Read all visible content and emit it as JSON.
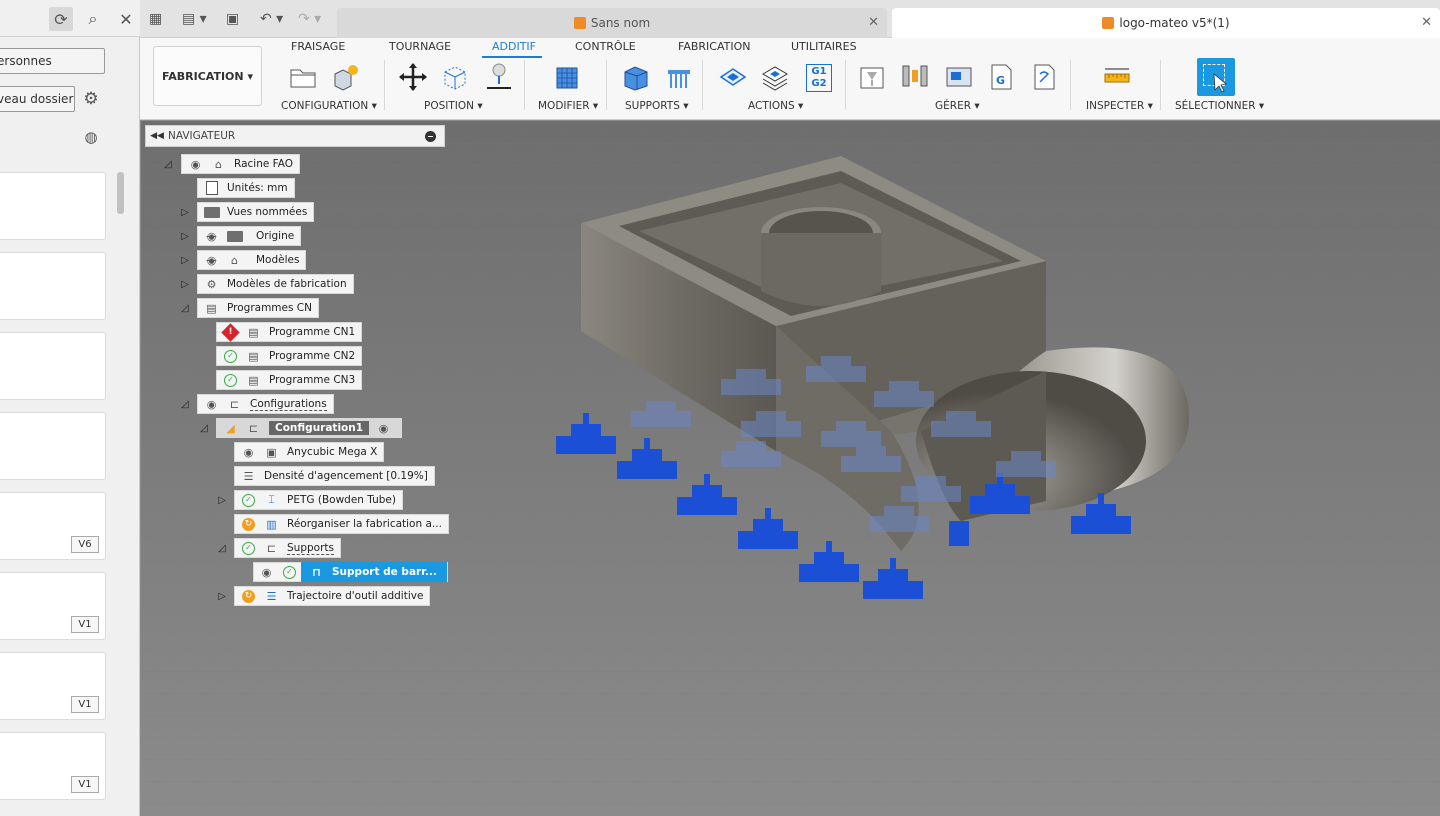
{
  "left_panel": {
    "share_field": "ersonnes",
    "new_folder_field": "veau dossier",
    "versions": [
      "V6",
      "V1",
      "V1",
      "V1"
    ]
  },
  "tabs": [
    {
      "label": "Sans nom",
      "active": false
    },
    {
      "label": "logo-mateo v5*(1)",
      "active": true
    }
  ],
  "ribbon": {
    "workspace_label": "FABRICATION",
    "tabs": [
      "FRAISAGE",
      "TOURNAGE",
      "ADDITIF",
      "CONTRÔLE",
      "FABRICATION",
      "UTILITAIRES"
    ],
    "active_tab": "ADDITIF",
    "groups": {
      "configuration": "CONFIGURATION",
      "position": "POSITION",
      "modifier": "MODIFIER",
      "supports": "SUPPORTS",
      "actions": "ACTIONS",
      "gerer": "GÉRER",
      "inspecter": "INSPECTER",
      "selectionner": "SÉLECTIONNER"
    },
    "g1g2": "G1 G2",
    "g_icon": "G",
    "accent_color": "#1a7fd4"
  },
  "browser": {
    "title": "NAVIGATEUR",
    "nodes": {
      "root": "Racine FAO",
      "units": "Unités: mm",
      "named_views": "Vues nommées",
      "origin": "Origine",
      "models": "Modèles",
      "fab_models": "Modèles de fabrication",
      "nc_programs": "Programmes CN",
      "nc1": "Programme CN1",
      "nc2": "Programme CN2",
      "nc3": "Programme CN3",
      "setups": "Configurations",
      "setup1": "Configuration1",
      "machine": "Anycubic Mega X",
      "density": "Densité d'agencement [0.19%]",
      "material": "PETG (Bowden Tube)",
      "arrange": "Réorganiser la fabrication a...",
      "supports": "Supports",
      "bar_support": "Support de barr...",
      "toolpath": "Trajectoire d'outil additive"
    },
    "selected_color": "#1a98e0"
  },
  "viewport": {
    "background": "#878787",
    "support_color": "#1a4fd6",
    "part_color": "#7d7a72"
  }
}
